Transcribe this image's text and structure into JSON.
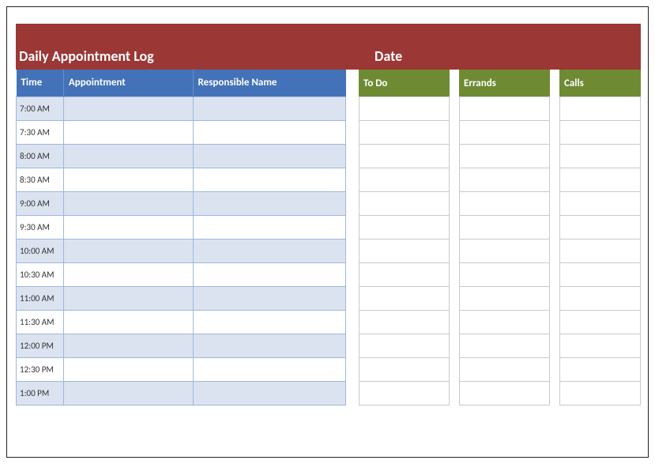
{
  "header": {
    "title": "Daily Appointment Log",
    "date_label": "Date"
  },
  "appointments": {
    "columns": {
      "time": "Time",
      "appointment": "Appointment",
      "responsible": "Responsible Name"
    },
    "rows": [
      {
        "time": "7:00 AM",
        "appointment": "",
        "responsible": ""
      },
      {
        "time": "7:30 AM",
        "appointment": "",
        "responsible": ""
      },
      {
        "time": "8:00 AM",
        "appointment": "",
        "responsible": ""
      },
      {
        "time": "8:30 AM",
        "appointment": "",
        "responsible": ""
      },
      {
        "time": "9:00 AM",
        "appointment": "",
        "responsible": ""
      },
      {
        "time": "9:30 AM",
        "appointment": "",
        "responsible": ""
      },
      {
        "time": "10:00 AM",
        "appointment": "",
        "responsible": ""
      },
      {
        "time": "10:30 AM",
        "appointment": "",
        "responsible": ""
      },
      {
        "time": "11:00 AM",
        "appointment": "",
        "responsible": ""
      },
      {
        "time": "11:30 AM",
        "appointment": "",
        "responsible": ""
      },
      {
        "time": "12:00 PM",
        "appointment": "",
        "responsible": ""
      },
      {
        "time": "12:30 PM",
        "appointment": "",
        "responsible": ""
      },
      {
        "time": "1:00 PM",
        "appointment": "",
        "responsible": ""
      }
    ]
  },
  "side_columns": {
    "todo": {
      "header": "To Do",
      "rows": [
        "",
        "",
        "",
        "",
        "",
        "",
        "",
        "",
        "",
        "",
        "",
        "",
        ""
      ]
    },
    "errands": {
      "header": "Errands",
      "rows": [
        "",
        "",
        "",
        "",
        "",
        "",
        "",
        "",
        "",
        "",
        "",
        "",
        ""
      ]
    },
    "calls": {
      "header": "Calls",
      "rows": [
        "",
        "",
        "",
        "",
        "",
        "",
        "",
        "",
        "",
        "",
        "",
        "",
        ""
      ]
    }
  },
  "colors": {
    "header_band": "#9b3735",
    "appt_header": "#4372b8",
    "side_header": "#6e8b33",
    "row_alt": "#dbe3f0"
  }
}
